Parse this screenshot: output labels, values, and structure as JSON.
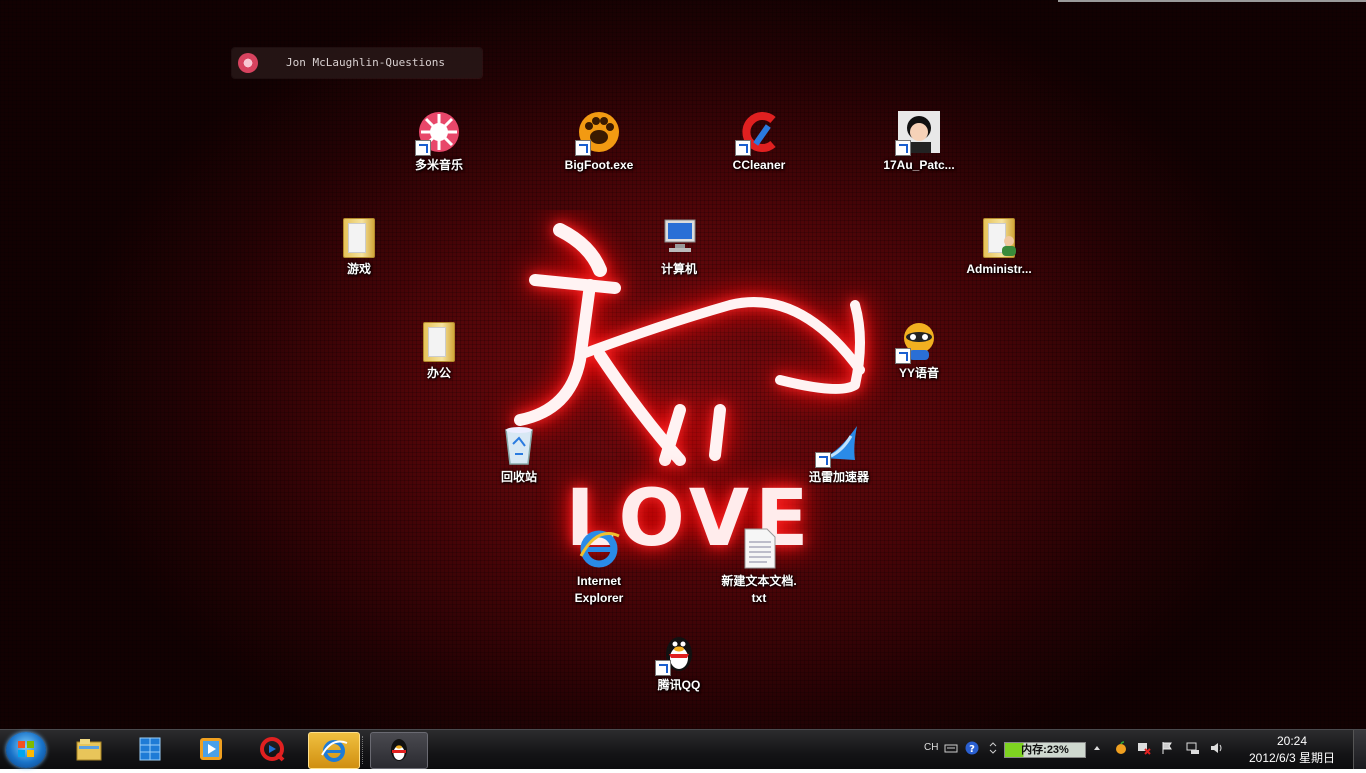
{
  "gadget": {
    "track": "Jon McLaughlin-Questions"
  },
  "wallpaper": {
    "text": "LOVE"
  },
  "desktop_icons": [
    {
      "label": "多米音乐"
    },
    {
      "label": "BigFoot.exe"
    },
    {
      "label": "CCleaner"
    },
    {
      "label": "17Au_Patc..."
    },
    {
      "label": "游戏"
    },
    {
      "label": "计算机"
    },
    {
      "label": "Administr..."
    },
    {
      "label": "办公"
    },
    {
      "label": "YY语音"
    },
    {
      "label": "回收站"
    },
    {
      "label": "迅雷加速器"
    },
    {
      "label": "Internet\nExplorer"
    },
    {
      "label": "新建文本文档.\ntxt"
    },
    {
      "label": "腾讯QQ"
    }
  ],
  "taskbar": {
    "pinned": [
      {
        "icon": "file-explorer-icon"
      },
      {
        "icon": "app-grid-icon"
      },
      {
        "icon": "media-player-icon"
      },
      {
        "icon": "qvod-player-icon"
      },
      {
        "icon": "internet-explorer-icon"
      }
    ],
    "open": [
      {
        "icon": "qq-penguin-icon"
      }
    ]
  },
  "tray": {
    "language": "CH",
    "memory": "内存:23%",
    "memory_percent": 23,
    "time": "20:24",
    "date": "2012/6/3 星期日"
  },
  "colors": {
    "accent": "#ff1a1a",
    "background": "#4d0508",
    "active_task": "#e0a020"
  }
}
